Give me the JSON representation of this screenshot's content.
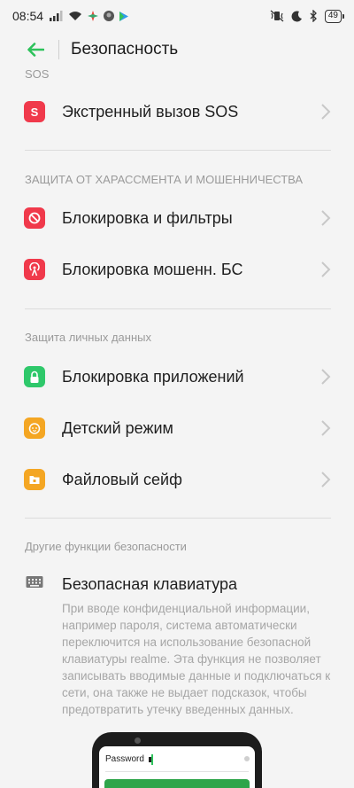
{
  "status_bar": {
    "time": "08:54",
    "battery": "49"
  },
  "header": {
    "title": "Безопасность"
  },
  "sections": {
    "sos": {
      "label": "SOS",
      "items": [
        {
          "label": "Экстренный вызов SOS",
          "icon": "sos-icon",
          "icon_text": "S",
          "color": "#f0394b"
        }
      ]
    },
    "harassment": {
      "label": "ЗАЩИТА ОТ ХАРАССМЕНТА И МОШЕННИЧЕСТВА",
      "items": [
        {
          "label": "Блокировка и фильтры",
          "icon": "block-icon",
          "color": "#f0394b"
        },
        {
          "label": "Блокировка мошенн. БС",
          "icon": "fraud-tower-icon",
          "color": "#f0394b"
        }
      ]
    },
    "privacy": {
      "label": "Защита личных данных",
      "items": [
        {
          "label": "Блокировка приложений",
          "icon": "lock-icon",
          "color": "#2ec86a"
        },
        {
          "label": "Детский режим",
          "icon": "kid-face-icon",
          "color": "#f4a623"
        },
        {
          "label": "Файловый сейф",
          "icon": "file-safe-icon",
          "color": "#f4a623"
        }
      ]
    },
    "other": {
      "label": "Другие функции безопасности",
      "keyboard": {
        "title": "Безопасная клавиатура",
        "description": "При вводе конфиденциальной информации, например пароля, система автоматически переключится на использование безопасной клавиатуры realme. Эта функция не позволяет записывать вводимые данные и подключаться к сети, она также не выдает подсказок, чтобы предотвратить утечку введенных данных.",
        "illustration": {
          "password_label": "Password"
        }
      }
    }
  },
  "colors": {
    "accent": "#2dc25b",
    "background": "#f4f4f4",
    "muted_text": "#9a9a9a"
  }
}
